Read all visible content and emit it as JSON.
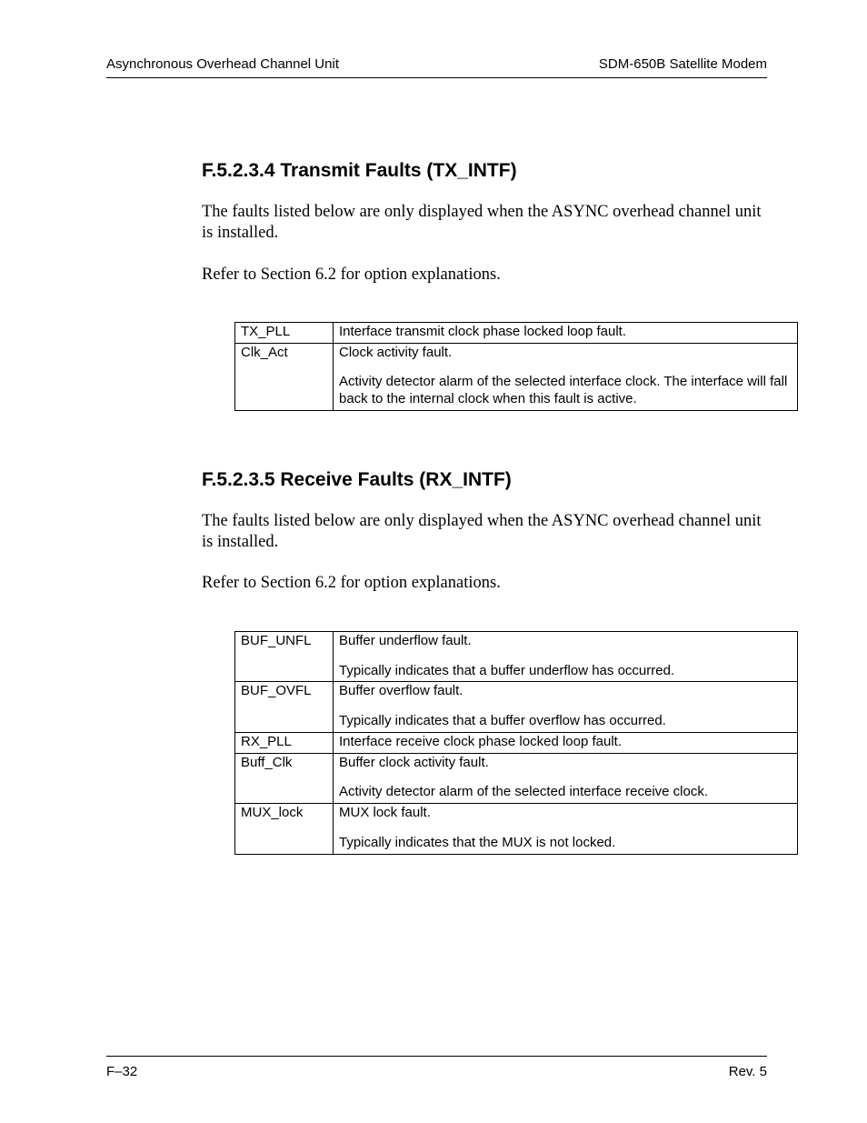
{
  "header": {
    "left": "Asynchronous Overhead Channel Unit",
    "right": "SDM-650B Satellite Modem"
  },
  "sections": [
    {
      "heading": "F.5.2.3.4  Transmit Faults (TX_INTF)",
      "paragraphs": [
        "The faults listed below are only displayed when the ASYNC overhead channel unit is installed.",
        "Refer to Section 6.2 for option explanations."
      ],
      "rows": [
        {
          "key": "TX_PLL",
          "main": "Interface transmit clock phase locked loop fault.",
          "extra": ""
        },
        {
          "key": "Clk_Act",
          "main": "Clock activity fault.",
          "extra": "Activity detector alarm of the selected interface clock. The interface will fall back to the internal clock when this fault is active."
        }
      ]
    },
    {
      "heading": "F.5.2.3.5  Receive Faults (RX_INTF)",
      "paragraphs": [
        "The faults listed below are only displayed when the ASYNC overhead channel unit is installed.",
        "Refer to Section 6.2 for option explanations."
      ],
      "rows": [
        {
          "key": "BUF_UNFL",
          "main": "Buffer underflow fault.",
          "extra": "Typically indicates that a buffer underflow has occurred."
        },
        {
          "key": "BUF_OVFL",
          "main": "Buffer overflow fault.",
          "extra": "Typically indicates that a buffer overflow has occurred."
        },
        {
          "key": "RX_PLL",
          "main": "Interface receive clock phase locked loop fault.",
          "extra": ""
        },
        {
          "key": "Buff_Clk",
          "main": "Buffer clock activity fault.",
          "extra": "Activity detector alarm of the selected interface receive clock."
        },
        {
          "key": "MUX_lock",
          "main": "MUX lock fault.",
          "extra": "Typically indicates that the MUX is not locked."
        }
      ]
    }
  ],
  "footer": {
    "left": "F–32",
    "right": "Rev. 5"
  }
}
